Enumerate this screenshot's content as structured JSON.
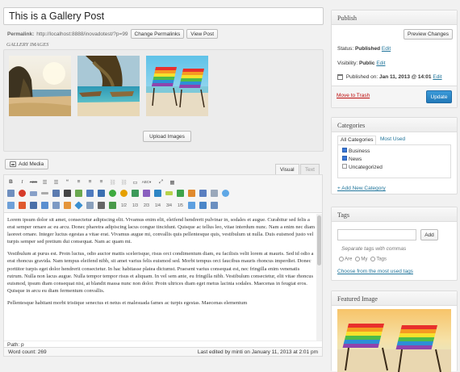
{
  "post": {
    "title": "This is a Gallery Post",
    "permalink_label": "Permalink:",
    "permalink_url": "http://localhost:8888/inovadotest/?p=99",
    "change_permalinks": "Change Permalinks",
    "view_post": "View Post",
    "gallery_label": "GALLERY IMAGES",
    "upload_images": "Upload Images"
  },
  "editor": {
    "add_media": "Add Media",
    "tab_visual": "Visual",
    "tab_text": "Text",
    "toolbar_row1": [
      "B",
      "I",
      "ABC",
      "≡",
      "≡",
      "66",
      "≡",
      "≡",
      "≡",
      "🔗",
      "⛓",
      "⊟",
      "ABC",
      "⤢",
      "▦"
    ],
    "toolbar_row2_labels": [
      "1/2",
      "1/3",
      "2/3",
      "1/4",
      "3/4",
      "1/5"
    ],
    "paragraphs": [
      "Lorem ipsum dolor sit amet, consectetur adipiscing elit. Vivamus enim elit, eleifend hendrerit pulvinar in, sodales et augue. Curabitur sed felis a erat semper ornare ac eu arcu. Donec pharetra adipiscing lacus congue tincidunt. Quisque ac tellus leo, vitae interdum nunc. Nam a enim nec diam laoreet ornare. Integer luctus egestas a vitae erat. Vivamus augue mi, convallis quis pellentesque quis, vestibulum ut nulla. Duis euismod justo vel turpis semper sed pretium dui consequat. Nam ac quam mi.",
      "Vestibulum at purus est. Proin luctus, odio auctor mattis scelerisque, risus orci condimentum diam, eu facilisis velit lorem at mauris. Sed id odio a erat rhoncus gravida. Nam tempus eleifend nibh, sit amet varius felis euismod sed. Morbi tempus orci faucibus mauris rhoncus imperdiet. Donec porttitor turpis eget dolor hendrerit consectetur. In hac habitasse platea dictumst. Praesent varius consequat est, nec fringilla enim venenatis rutrum. Nulla non lacus augue. Nulla tempor tempor risus et aliquam. In vel sem ante, eu fringilla nibh. Vestibulum consectetur, elit vitae rhoncus euismod, ipsum diam consequat nisi, at blandit massa nunc non dolor. Proin ultrices diam eget metus lacinia sodales. Maecenas in feugiat eros. Quisque in arcu eu diam fermentum convallis.",
      "Pellentesque habitant morbi tristique senectus et netus et malesuada fames ac turpis egestas. Maecenas elementum"
    ],
    "path": "Path: p",
    "word_count": "Word count: 269",
    "last_edited": "Last edited by minti on January 11, 2013 at 2:01 pm"
  },
  "publish": {
    "title": "Publish",
    "preview_changes": "Preview Changes",
    "status_label": "Status:",
    "status_value": "Published",
    "visibility_label": "Visibility:",
    "visibility_value": "Public",
    "published_on_label": "Published on:",
    "published_on_value": "Jan 11, 2013 @ 14:01",
    "edit": "Edit",
    "move_to_trash": "Move to Trash",
    "update": "Update"
  },
  "categories": {
    "title": "Categories",
    "tab_all": "All Categories",
    "tab_most_used": "Most Used",
    "items": [
      {
        "label": "Business",
        "checked": true
      },
      {
        "label": "News",
        "checked": true
      },
      {
        "label": "Uncategorized",
        "checked": false
      }
    ],
    "add_new": "+ Add New Category"
  },
  "tags": {
    "title": "Tags",
    "add_button": "Add",
    "hint": "Separate tags with commas",
    "options": [
      "Are",
      "My",
      "Tags"
    ],
    "choose_link": "Choose from the most used tags"
  },
  "featured": {
    "title": "Featured Image"
  },
  "colors": {
    "accent": "#21759b",
    "update_button": "#2e8bcc",
    "trash": "#bc0b0b"
  }
}
